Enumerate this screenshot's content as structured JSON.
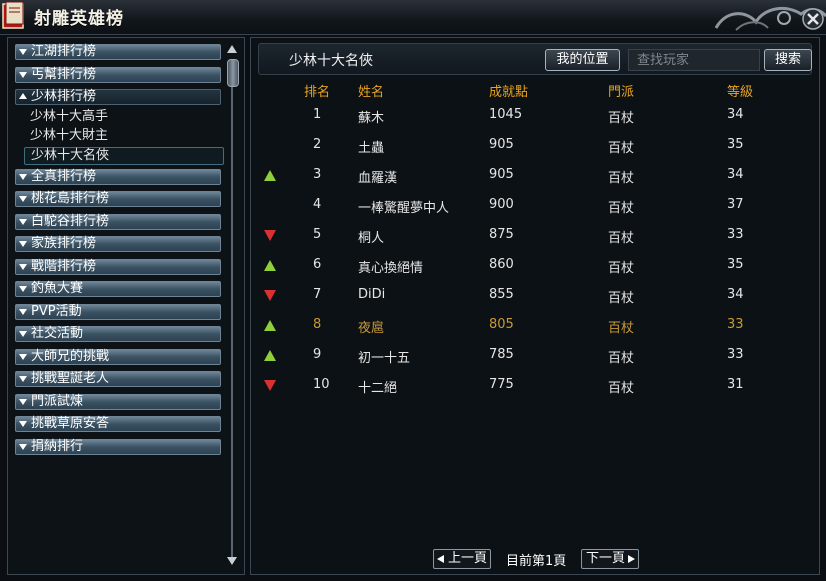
{
  "window": {
    "title": "射雕英雄榜"
  },
  "sidebar": {
    "categories": [
      {
        "label": "江湖排行榜",
        "open": false
      },
      {
        "label": "丐幫排行榜",
        "open": false
      },
      {
        "label": "少林排行榜",
        "open": true,
        "subs": [
          "少林十大高手",
          "少林十大財主",
          "少林十大名俠"
        ],
        "selected": 2
      },
      {
        "label": "全真排行榜",
        "open": false
      },
      {
        "label": "桃花島排行榜",
        "open": false
      },
      {
        "label": "白駝谷排行榜",
        "open": false
      },
      {
        "label": "家族排行榜",
        "open": false
      },
      {
        "label": "戰階排行榜",
        "open": false
      },
      {
        "label": "釣魚大賽",
        "open": false
      },
      {
        "label": "PVP活動",
        "open": false
      },
      {
        "label": "社交活動",
        "open": false
      },
      {
        "label": "大師兄的挑戰",
        "open": false
      },
      {
        "label": "挑戰聖誕老人",
        "open": false
      },
      {
        "label": "門派試煉",
        "open": false
      },
      {
        "label": "挑戰草原安答",
        "open": false
      },
      {
        "label": "捐納排行",
        "open": false
      }
    ]
  },
  "main": {
    "section_title": "少林十大名俠",
    "my_position_label": "我的位置",
    "search_placeholder": "查找玩家",
    "search_label": "搜索",
    "columns": {
      "rank": "排名",
      "name": "姓名",
      "score": "成就點",
      "sect": "門派",
      "level": "等級"
    },
    "rows": [
      {
        "trend": "none",
        "rank": "1",
        "name": "蘇木",
        "score": "1045",
        "sect": "百杖",
        "level": "34",
        "mine": false
      },
      {
        "trend": "none",
        "rank": "2",
        "name": "土蟲",
        "score": "905",
        "sect": "百杖",
        "level": "35",
        "mine": false
      },
      {
        "trend": "up",
        "rank": "3",
        "name": "血羅漢",
        "score": "905",
        "sect": "百杖",
        "level": "34",
        "mine": false
      },
      {
        "trend": "none",
        "rank": "4",
        "name": "一棒驚醒夢中人",
        "score": "900",
        "sect": "百杖",
        "level": "37",
        "mine": false
      },
      {
        "trend": "down",
        "rank": "5",
        "name": "桐人",
        "score": "875",
        "sect": "百杖",
        "level": "33",
        "mine": false
      },
      {
        "trend": "up",
        "rank": "6",
        "name": "真心換絕情",
        "score": "860",
        "sect": "百杖",
        "level": "35",
        "mine": false
      },
      {
        "trend": "down",
        "rank": "7",
        "name": "DiDi",
        "score": "855",
        "sect": "百杖",
        "level": "34",
        "mine": false
      },
      {
        "trend": "up",
        "rank": "8",
        "name": "夜扈",
        "score": "805",
        "sect": "百杖",
        "level": "33",
        "mine": true
      },
      {
        "trend": "up",
        "rank": "9",
        "name": "初一十五",
        "score": "785",
        "sect": "百杖",
        "level": "33",
        "mine": false
      },
      {
        "trend": "down",
        "rank": "10",
        "name": "十二絕",
        "score": "775",
        "sect": "百杖",
        "level": "31",
        "mine": false
      }
    ],
    "pager": {
      "prev_label": "上一頁",
      "current": "目前第1頁",
      "next_label": "下一頁"
    }
  },
  "colors": {
    "header_text": "#e8a31f",
    "my_row_text": "#c99a38",
    "trend_up": "#8fcf3a",
    "trend_down": "#d93030"
  },
  "icons": {
    "window": "book-icon",
    "close": "close-icon",
    "trend_up": "trend-up-icon",
    "trend_down": "trend-down-icon"
  }
}
